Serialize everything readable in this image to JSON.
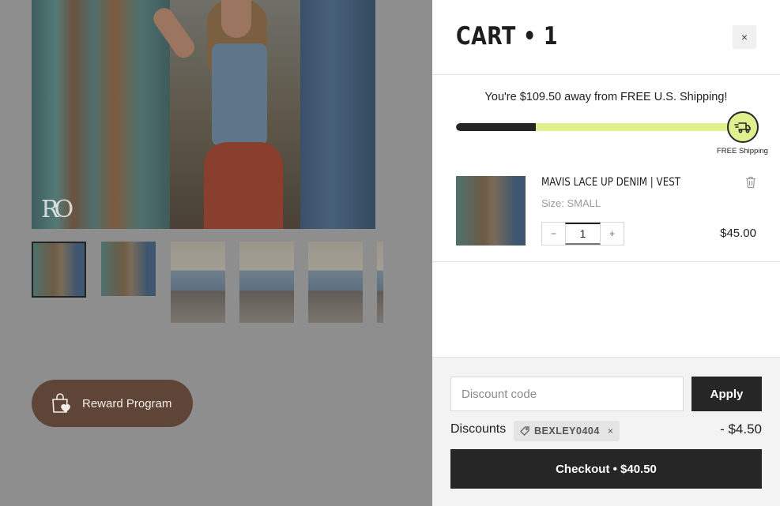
{
  "product_page": {
    "hero_logo": "RO",
    "reward_button_label": "Reward Program"
  },
  "cart": {
    "title": "CART • 1",
    "close_glyph": "×",
    "shipping": {
      "message": "You're $109.50 away from FREE U.S. Shipping!",
      "progress_fraction": 0.27,
      "goal_label": "FREE Shipping"
    },
    "items": [
      {
        "name": "MAVIS LACE UP DENIM | VEST",
        "size_text": "Size: SMALL",
        "quantity": "1",
        "price": "$45.00"
      }
    ],
    "discount": {
      "placeholder": "Discount code",
      "apply_label": "Apply",
      "label": "Discounts",
      "code": "BEXLEY0404",
      "amount": "- $4.50"
    },
    "checkout_label": "Checkout • $40.50"
  },
  "colors": {
    "accent_green": "#e1f08f",
    "dark": "#262626",
    "reward_brown": "#5e4537"
  }
}
